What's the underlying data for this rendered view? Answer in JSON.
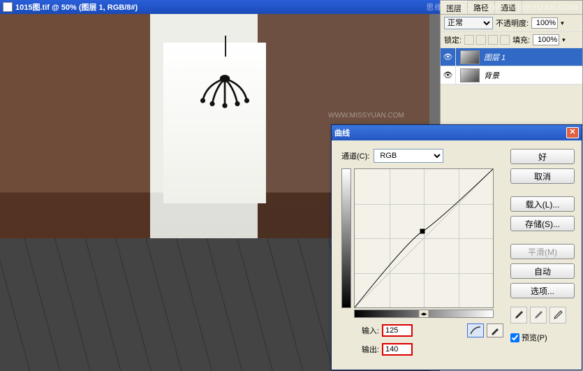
{
  "document": {
    "title": "1015图.tif @ 50% (图层 1, RGB/8#)"
  },
  "layers_panel": {
    "tabs": [
      "图层",
      "路径",
      "通道"
    ],
    "blend_mode": "正常",
    "opacity_label": "不透明度:",
    "opacity_value": "100%",
    "lock_label": "锁定:",
    "fill_label": "填充:",
    "fill_value": "100%",
    "layers": [
      {
        "name": "图层 1",
        "active": true
      },
      {
        "name": "背景",
        "active": false
      }
    ]
  },
  "curves": {
    "title": "曲线",
    "channel_label": "通道(C):",
    "channel_value": "RGB",
    "input_label": "输入:",
    "input_value": "125",
    "output_label": "输出:",
    "output_value": "140",
    "buttons": {
      "ok": "好",
      "cancel": "取消",
      "load": "载入(L)...",
      "save": "存储(S)...",
      "smooth": "平滑(M)",
      "auto": "自动",
      "options": "选项..."
    },
    "preview_label": "预览(P)"
  },
  "watermark": {
    "brand": "思缘设计论坛",
    "url": "WWW.MISSYUAN.COM"
  },
  "chart_data": {
    "type": "line",
    "title": "曲线",
    "xlabel": "输入",
    "ylabel": "输出",
    "xlim": [
      0,
      255
    ],
    "ylim": [
      0,
      255
    ],
    "series": [
      {
        "name": "RGB",
        "points": [
          [
            0,
            0
          ],
          [
            125,
            140
          ],
          [
            255,
            255
          ]
        ]
      }
    ]
  }
}
